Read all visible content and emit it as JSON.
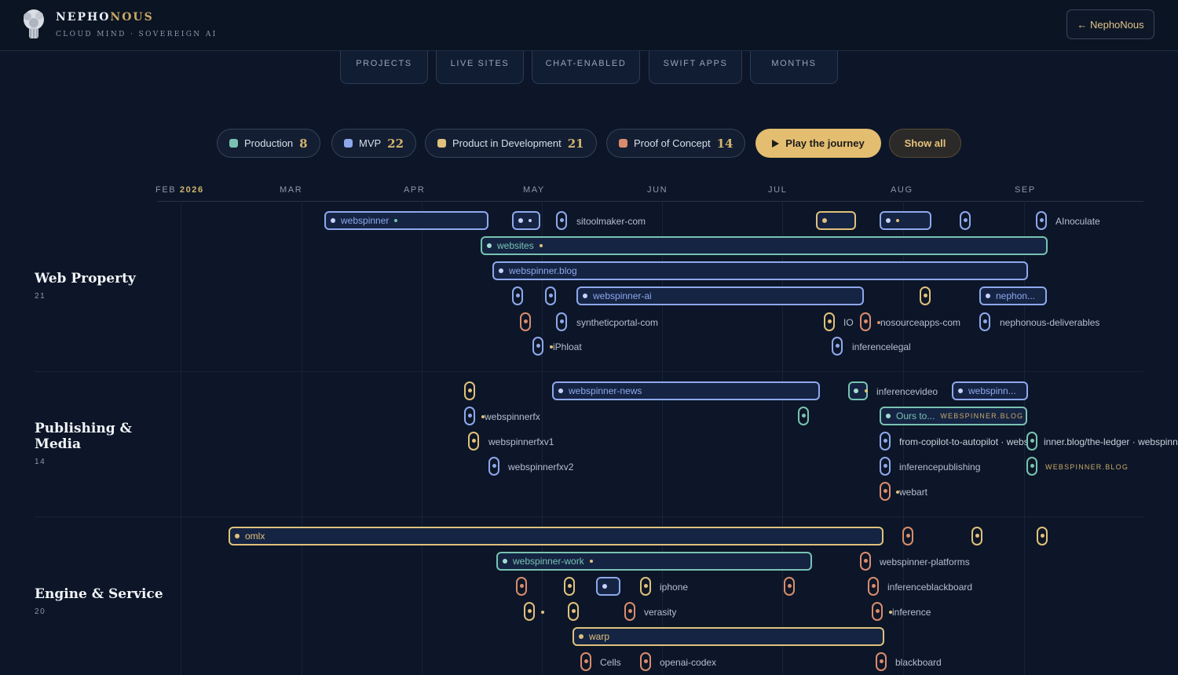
{
  "brand": {
    "name_a": "NEPHO",
    "name_b": "NOUS",
    "tagline": "CLOUD MIND · SOVEREIGN AI",
    "back_label": "← NephoNous"
  },
  "stats": [
    "PROJECTS",
    "LIVE SITES",
    "CHAT-ENABLED",
    "SWIFT APPS",
    "MONTHS"
  ],
  "filters": [
    {
      "label": "Production",
      "count": "8",
      "color": "#79c2b2"
    },
    {
      "label": "MVP",
      "count": "22",
      "color": "#8ea8ec"
    },
    {
      "label": "Product in Development",
      "count": "21",
      "color": "#e0c17b"
    },
    {
      "label": "Proof of Concept",
      "count": "14",
      "color": "#d98c6d"
    }
  ],
  "controls": {
    "play": "Play the journey",
    "show_all": "Show all"
  },
  "months": [
    "FEB",
    "2026",
    "MAR",
    "APR",
    "MAY",
    "JUN",
    "JUL",
    "AUG",
    "SEP"
  ],
  "status_colors": {
    "production": "#79c2b2",
    "mvp": "#8ea8ec",
    "development": "#e0c17b",
    "poc": "#d98c6d"
  },
  "sections": [
    {
      "title": "Web Property",
      "count": "21"
    },
    {
      "title": "Publishing & Media",
      "count": "14"
    },
    {
      "title": "Engine & Service",
      "count": "20"
    }
  ],
  "web_property": {
    "bars": [
      "webspinner",
      "websites",
      "webspinner.blog",
      "webspinner-ai",
      "nephon..."
    ],
    "labels": [
      "sitoolmaker-com",
      "AInoculate",
      "syntheticportal-com",
      "IO",
      "nosourceapps-com",
      "nephonous-deliverables",
      "iPhloat",
      "inferencelegal"
    ]
  },
  "publishing": {
    "bars": [
      "webspinner-news",
      "webspinn...",
      "Ours to..."
    ],
    "labels": [
      "webspinnerfx",
      "webspinnerfxv1",
      "webspinnerfxv2",
      "inferencevideo",
      "inferencepublishing",
      "webart"
    ],
    "overlap_text": "from-copilot-to-autopilot · websp",
    "overlap_text2": "inner.blog/the-ledger · webspinne",
    "tags": [
      "WEBSPINNER.BLOG",
      "WEBSPINNER.BLOG"
    ]
  },
  "engine": {
    "bars": [
      "omlx",
      "webspinner-work",
      "warp"
    ],
    "labels": [
      "webspinner-platforms",
      "iphone",
      "inferenceblackboard",
      "verasity",
      "inference",
      "Cells",
      "openai-codex",
      "blackboard"
    ]
  }
}
